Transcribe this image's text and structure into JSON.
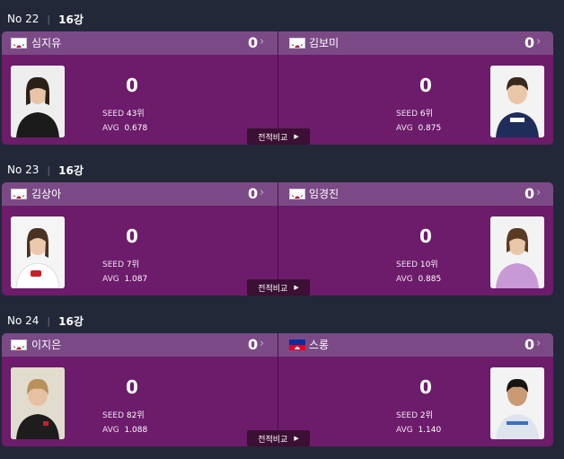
{
  "matches": [
    {
      "no": "No 22",
      "round": "16강",
      "left": {
        "name": "심지유",
        "set_score": "0",
        "score": "0",
        "seed": "43위",
        "avg": "0.678"
      },
      "right": {
        "name": "김보미",
        "set_score": "0",
        "score": "0",
        "seed": "6위",
        "avg": "0.875"
      }
    },
    {
      "no": "No 23",
      "round": "16강",
      "left": {
        "name": "김상아",
        "set_score": "0",
        "score": "0",
        "seed": "7위",
        "avg": "1.087"
      },
      "right": {
        "name": "임경진",
        "set_score": "0",
        "score": "0",
        "seed": "10위",
        "avg": "0.885"
      }
    },
    {
      "no": "No 24",
      "round": "16강",
      "left": {
        "name": "이지은",
        "set_score": "0",
        "score": "0",
        "seed": "82위",
        "avg": "1.088"
      },
      "right": {
        "name": "스롱",
        "set_score": "0",
        "score": "0",
        "seed": "2위",
        "avg": "1.140"
      }
    }
  ],
  "labels": {
    "seed": "SEED",
    "avg": "AVG",
    "compare": "전적비교",
    "chevron": "›",
    "separator": "|"
  },
  "icons": {
    "compare_arrow": "play-triangle-icon",
    "chevron": "chevron-right-icon"
  },
  "colors": {
    "card": "#6c1c6a",
    "player_bar": "#7b4a86",
    "background": "#232838",
    "compare_button": "#3c0f34"
  }
}
